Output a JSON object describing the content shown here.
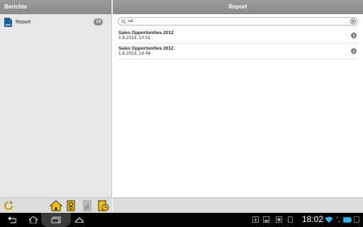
{
  "sidebar": {
    "header": "Berichte",
    "items": [
      {
        "label": "Report",
        "count": "14"
      }
    ]
  },
  "main": {
    "header": "Report",
    "search": {
      "value": "sal"
    },
    "results": [
      {
        "title": "Sales Opportunities 2012",
        "date": "1.8.2013, 10:01"
      },
      {
        "title": "Sales Opportunities 2012",
        "date": "1.8.2013, 14:46"
      }
    ]
  },
  "system_bar": {
    "time": "18:02"
  },
  "colors": {
    "header_bg": "#8f8f8f",
    "sidebar_bg": "#e7e7e7",
    "toolbar_bg": "#dcdcdc",
    "icon_yellow": "#f3c300",
    "system_bar_bg": "#000000",
    "wifi_blue": "#33b5e5"
  }
}
